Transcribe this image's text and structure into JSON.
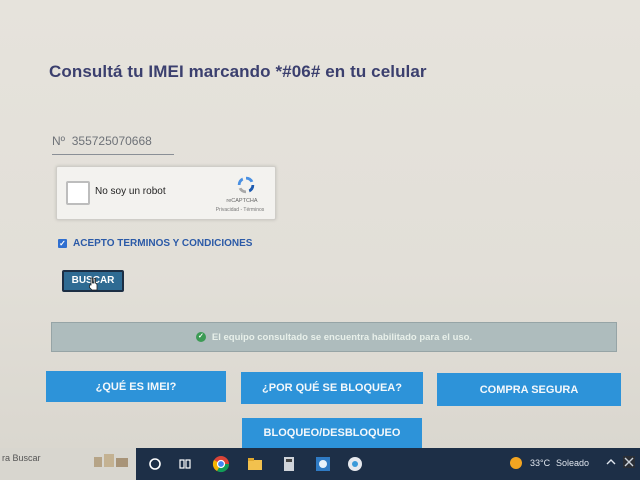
{
  "page": {
    "title": "Consultá tu IMEI marcando *#06# en tu celular",
    "imei": {
      "prefix": "Nº",
      "value": "355725070668"
    },
    "captcha": {
      "label": "No soy un robot",
      "brand": "reCAPTCHA",
      "links": "Privacidad - Términos"
    },
    "terms": {
      "label": "ACEPTO TERMINOS Y CONDICIONES",
      "checked": true
    },
    "search_button": "BUSCAR",
    "alert": "El equipo consultado se encuentra habilitado para el uso.",
    "buttons": {
      "que_es": "¿QUÉ ES IMEI?",
      "por_que": "¿POR QUÉ SE BLOQUEA?",
      "compra": "COMPRA SEGURA",
      "bloqueo": "BLOQUEO/DESBLOQUEO"
    }
  },
  "taskbar": {
    "search_text": "ra Buscar",
    "weather_temp": "33°C",
    "weather_text": "Soleado",
    "icons": [
      "search-circle-icon",
      "task-view-icon",
      "chrome-icon",
      "file-explorer-icon",
      "calculator-icon",
      "photos-icon",
      "app-icon"
    ]
  },
  "colors": {
    "title": "#3b3f6e",
    "button": "#2d93d9",
    "taskbar": "#1d2f47"
  }
}
